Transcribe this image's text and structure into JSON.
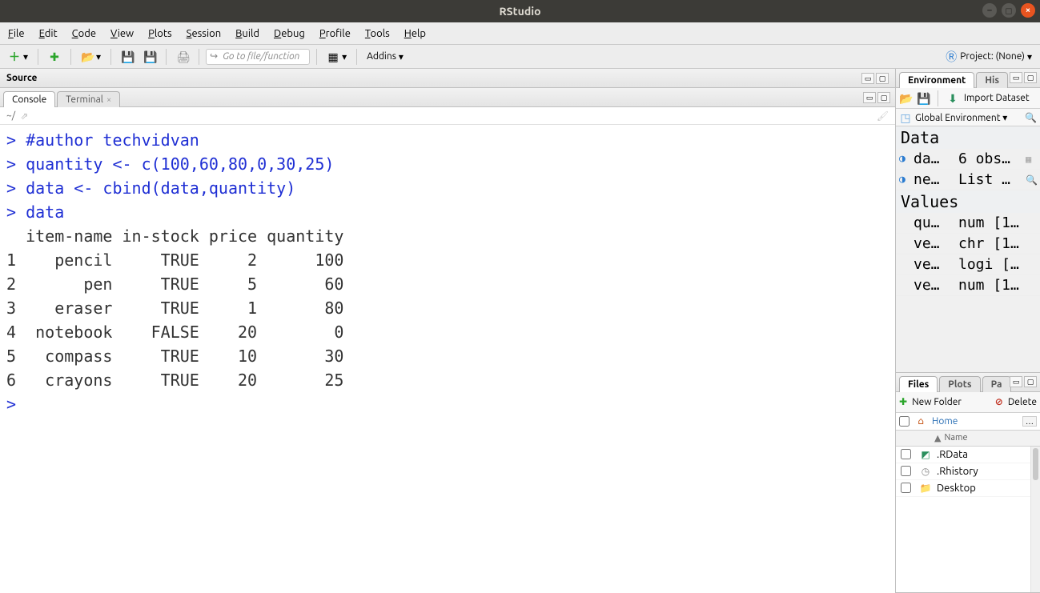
{
  "window": {
    "title": "RStudio"
  },
  "menu": {
    "file": "File",
    "edit": "Edit",
    "code": "Code",
    "view": "View",
    "plots": "Plots",
    "session": "Session",
    "build": "Build",
    "debug": "Debug",
    "profile": "Profile",
    "tools": "Tools",
    "help": "Help"
  },
  "toolbar": {
    "goto_placeholder": "Go to file/function",
    "addins": "Addins",
    "project_label": "Project: (None)"
  },
  "source": {
    "title": "Source"
  },
  "console": {
    "tab_console": "Console",
    "tab_terminal": "Terminal",
    "path": "~/",
    "lines": [
      {
        "type": "in",
        "text": "#author techvidvan"
      },
      {
        "type": "in",
        "text": "quantity <- c(100,60,80,0,30,25)"
      },
      {
        "type": "in",
        "text": "data <- cbind(data,quantity)"
      },
      {
        "type": "in",
        "text": "data"
      },
      {
        "type": "out",
        "text": "  item-name in-stock price quantity"
      },
      {
        "type": "out",
        "text": "1    pencil     TRUE     2      100"
      },
      {
        "type": "out",
        "text": "2       pen     TRUE     5       60"
      },
      {
        "type": "out",
        "text": "3    eraser     TRUE     1       80"
      },
      {
        "type": "out",
        "text": "4  notebook    FALSE    20        0"
      },
      {
        "type": "out",
        "text": "5   compass     TRUE    10       30"
      },
      {
        "type": "out",
        "text": "6   crayons     TRUE    20       25"
      }
    ],
    "table": {
      "columns": [
        "item-name",
        "in-stock",
        "price",
        "quantity"
      ],
      "rows": [
        {
          "idx": 1,
          "item-name": "pencil",
          "in-stock": "TRUE",
          "price": 2,
          "quantity": 100
        },
        {
          "idx": 2,
          "item-name": "pen",
          "in-stock": "TRUE",
          "price": 5,
          "quantity": 60
        },
        {
          "idx": 3,
          "item-name": "eraser",
          "in-stock": "TRUE",
          "price": 1,
          "quantity": 80
        },
        {
          "idx": 4,
          "item-name": "notebook",
          "in-stock": "FALSE",
          "price": 20,
          "quantity": 0
        },
        {
          "idx": 5,
          "item-name": "compass",
          "in-stock": "TRUE",
          "price": 10,
          "quantity": 30
        },
        {
          "idx": 6,
          "item-name": "crayons",
          "in-stock": "TRUE",
          "price": 20,
          "quantity": 25
        }
      ]
    }
  },
  "env": {
    "tab_env": "Environment",
    "tab_hist": "His",
    "import": "Import Dataset",
    "scope": "Global Environment",
    "section_data": "Data",
    "section_values": "Values",
    "data_rows": [
      {
        "name": "da…",
        "value": "6 obs…",
        "expandable": true,
        "grid": true
      },
      {
        "name": "ne…",
        "value": "List …",
        "expandable": true,
        "grid": false,
        "search": true
      }
    ],
    "value_rows": [
      {
        "name": "qu…",
        "value": "num [1…"
      },
      {
        "name": "ve…",
        "value": "chr [1…"
      },
      {
        "name": "ve…",
        "value": "logi […"
      },
      {
        "name": "ve…",
        "value": "num [1…"
      }
    ]
  },
  "files": {
    "tab_files": "Files",
    "tab_plots": "Plots",
    "tab_packages": "Pa",
    "new_folder": "New Folder",
    "delete": "Delete",
    "home": "Home",
    "col_name": "Name",
    "entries": [
      {
        "icon": "rdata",
        "name": ".RData"
      },
      {
        "icon": "hist",
        "name": ".Rhistory"
      },
      {
        "icon": "folder",
        "name": "Desktop"
      }
    ]
  }
}
